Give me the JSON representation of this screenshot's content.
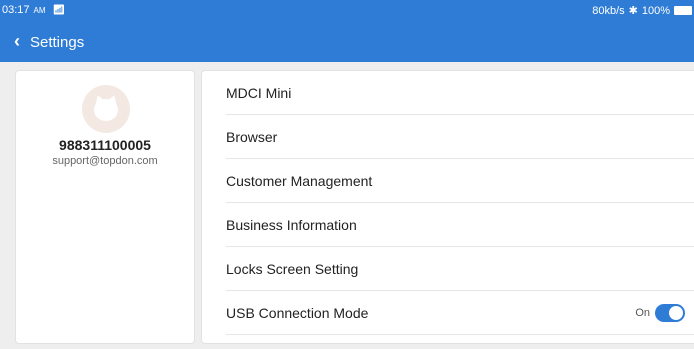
{
  "status_bar": {
    "time": "03:17",
    "ampm": "AM",
    "wifi_icon": "wifi-icon",
    "net_speed": "80kb/s",
    "bluetooth_icon": "bluetooth-icon",
    "battery": "100%"
  },
  "nav": {
    "title": "Settings",
    "back_icon": "chevron-left-icon"
  },
  "profile": {
    "user_id": "988311100005",
    "email": "support@topdon.com"
  },
  "menu": {
    "items": [
      {
        "label": "MDCI Mini"
      },
      {
        "label": "Browser"
      },
      {
        "label": "Customer Management"
      },
      {
        "label": "Business Information"
      },
      {
        "label": "Locks Screen Setting"
      },
      {
        "label": "USB Connection Mode",
        "toggle_label": "On",
        "toggle_state": true
      }
    ]
  },
  "colors": {
    "accent": "#2f7cd6",
    "background": "#eeeeee"
  }
}
